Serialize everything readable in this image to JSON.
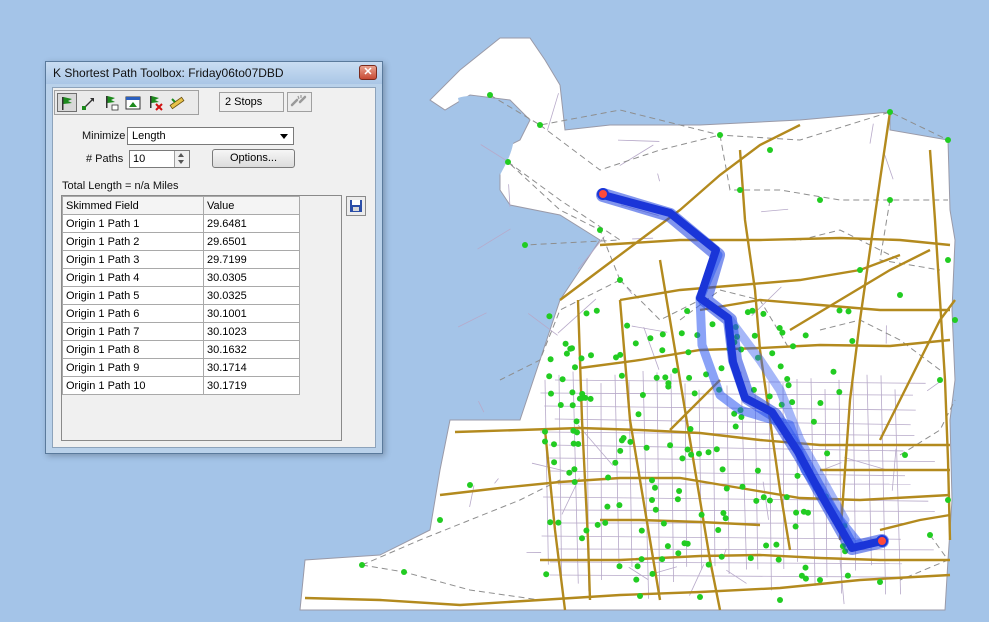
{
  "window": {
    "title": "K Shortest Path Toolbox: Friday06to07DBD",
    "close_glyph": "✕"
  },
  "toolbar": {
    "tools": [
      "add-stop-flag-icon",
      "draw-link-icon",
      "flag-settings-icon",
      "map-window-icon",
      "remove-flag-icon",
      "ruler-icon"
    ],
    "stops_label": "2 Stops",
    "reset_icon": "broken-link-icon"
  },
  "form": {
    "minimize_label": "Minimize",
    "minimize_value": "Length",
    "paths_label": "# Paths",
    "paths_value": "10",
    "options_label": "Options..."
  },
  "total_length": "Total Length = n/a Miles",
  "table": {
    "columns": [
      "Skimmed Field",
      "Value"
    ],
    "rows": [
      [
        "Origin 1 Path 1",
        "29.6481"
      ],
      [
        "Origin 1 Path 2",
        "29.6501"
      ],
      [
        "Origin 1 Path 3",
        "29.7199"
      ],
      [
        "Origin 1 Path 4",
        "30.0305"
      ],
      [
        "Origin 1 Path 5",
        "30.0325"
      ],
      [
        "Origin 1 Path 6",
        "30.1001"
      ],
      [
        "Origin 1 Path 7",
        "30.1023"
      ],
      [
        "Origin 1 Path 8",
        "30.1632"
      ],
      [
        "Origin 1 Path 9",
        "30.1714"
      ],
      [
        "Origin 1 Path 10",
        "30.1719"
      ]
    ]
  },
  "save_icon": "floppy-disk-icon",
  "colors": {
    "background": "#a4c4e8",
    "land": "#ffffff",
    "highway": "#b38a1e",
    "route": "#1a3ee0",
    "centroid": "#22cc22",
    "connector": "#909090"
  }
}
